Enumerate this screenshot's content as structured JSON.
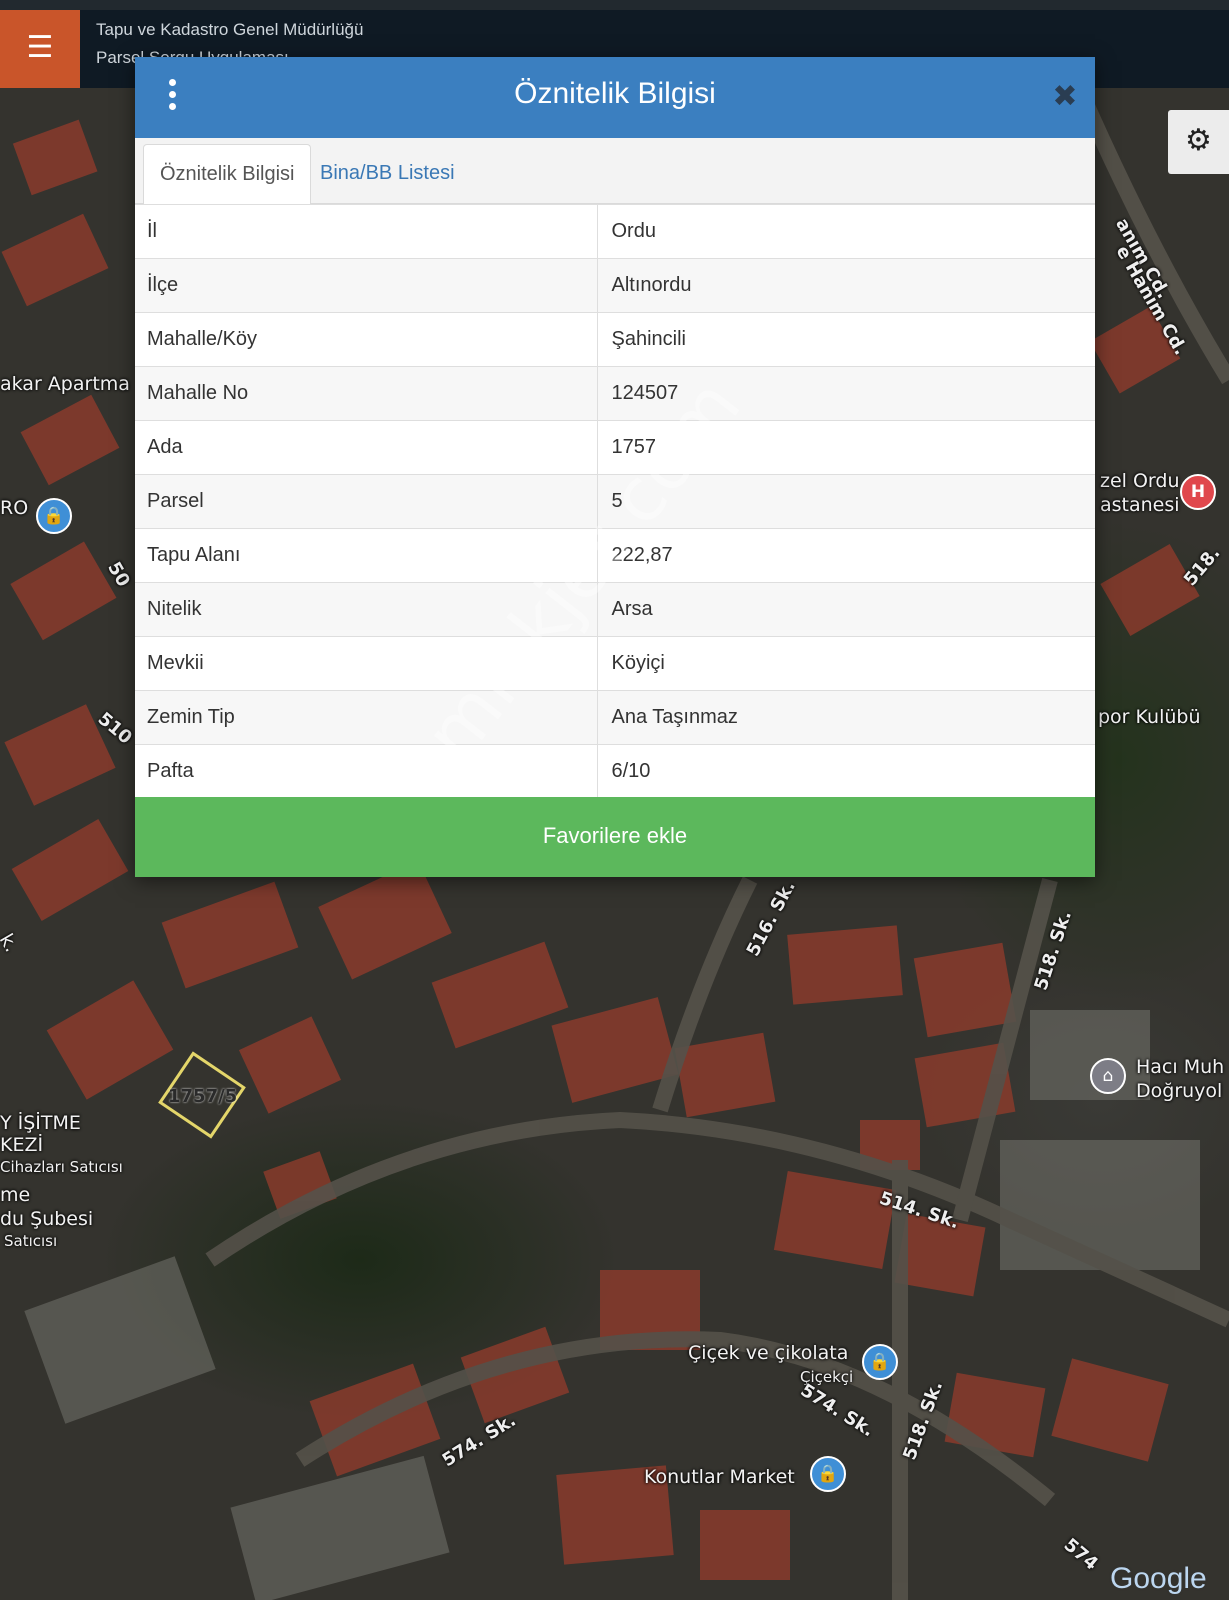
{
  "header": {
    "title": "Tapu ve Kadastro Genel Müdürlüğü",
    "subtitle": "Parsel Sorgu Uygulaması",
    "menu_icon": "☰",
    "settings_icon": "⚙"
  },
  "modal": {
    "title": "Öznitelik Bilgisi",
    "close_icon": "✖",
    "tabs": [
      {
        "label": "Öznitelik Bilgisi",
        "active": true
      },
      {
        "label": "Bina/BB Listesi",
        "active": false
      }
    ],
    "rows": [
      {
        "key": "İl",
        "value": "Ordu"
      },
      {
        "key": "İlçe",
        "value": "Altınordu"
      },
      {
        "key": "Mahalle/Köy",
        "value": "Şahincili"
      },
      {
        "key": "Mahalle No",
        "value": "124507"
      },
      {
        "key": "Ada",
        "value": "1757"
      },
      {
        "key": "Parsel",
        "value": "5"
      },
      {
        "key": "Tapu Alanı",
        "value": "222,87"
      },
      {
        "key": "Nitelik",
        "value": "Arsa"
      },
      {
        "key": "Mevkii",
        "value": "Köyiçi"
      },
      {
        "key": "Zemin Tip",
        "value": "Ana Taşınmaz"
      },
      {
        "key": "Pafta",
        "value": "6/10"
      }
    ],
    "favorite_button": "Favorilere ekle"
  },
  "map": {
    "labels": {
      "apartment": "akar Apartma",
      "ro": "RO",
      "road_510": "510",
      "road_50": "50",
      "hanim_cd1": "anım Cd.",
      "hanim_cd2": "e Hanım Cd.",
      "ordu_hospital": "zel Ordu",
      "hospital2": "astanesi",
      "road_518_top": "518.",
      "kulubu": "por Kulübü",
      "road_516": "516. Sk.",
      "road_518a": "518. Sk.",
      "haci": "Hacı Muh",
      "dogruyol": "Doğruyol",
      "parcel_label": "1757/5",
      "isitme": "Y İŞİTME",
      "kezi": "KEZİ",
      "cihaz": "Cihazları Satıcısı",
      "me": "me",
      "subesi": "du Şubesi",
      "satici": "Satıcısı",
      "road_514": "514. Sk.",
      "cicek": "Çiçek ve çikolata",
      "cicekci": "Çiçekçi",
      "road_574a": "574. Sk.",
      "road_574b": "574. Sk.",
      "road_518b": "518. Sk.",
      "konutlar": "Konutlar Market",
      "road_574c": "574",
      "k_label": "k.",
      "google": "Google"
    }
  },
  "watermark": "emlakjet.com",
  "colors": {
    "header_bg": "#0f1a24",
    "menu_btn": "#c9552a",
    "modal_header": "#3b7fc0",
    "tab_link": "#3a78b5",
    "favorite_btn": "#5cb85c"
  }
}
